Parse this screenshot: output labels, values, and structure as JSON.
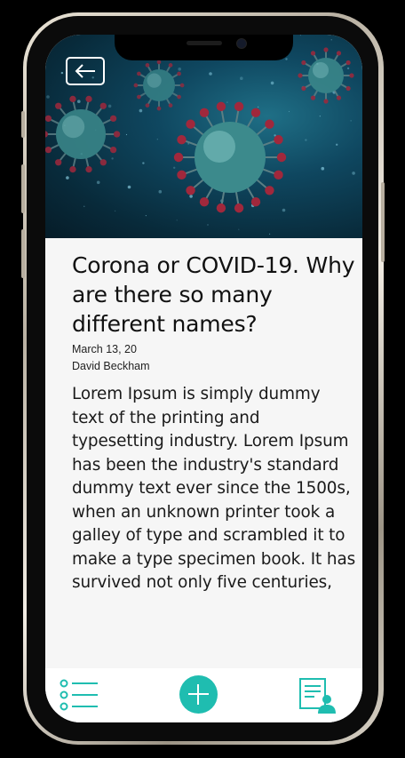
{
  "article": {
    "title": "Corona or COVID-19. Why are there so many different names?",
    "date": "March 13, 20",
    "author": "David Beckham",
    "body": "Lorem Ipsum is simply dummy text of the printing and typesetting industry. Lorem Ipsum has been the industry's standard dummy text ever since the 1500s, when an unknown printer took a galley of type and scrambled it to make a type specimen book. It has survived not only five centuries,"
  },
  "icons": {
    "back": "arrow-left-icon",
    "list": "list-icon",
    "add": "plus-icon",
    "profile": "user-document-icon"
  },
  "colors": {
    "accent": "#1fbdb0",
    "hero_bg": "#0f4760",
    "virus_body": "#3c8a8c",
    "virus_spike": "#a0283c"
  }
}
